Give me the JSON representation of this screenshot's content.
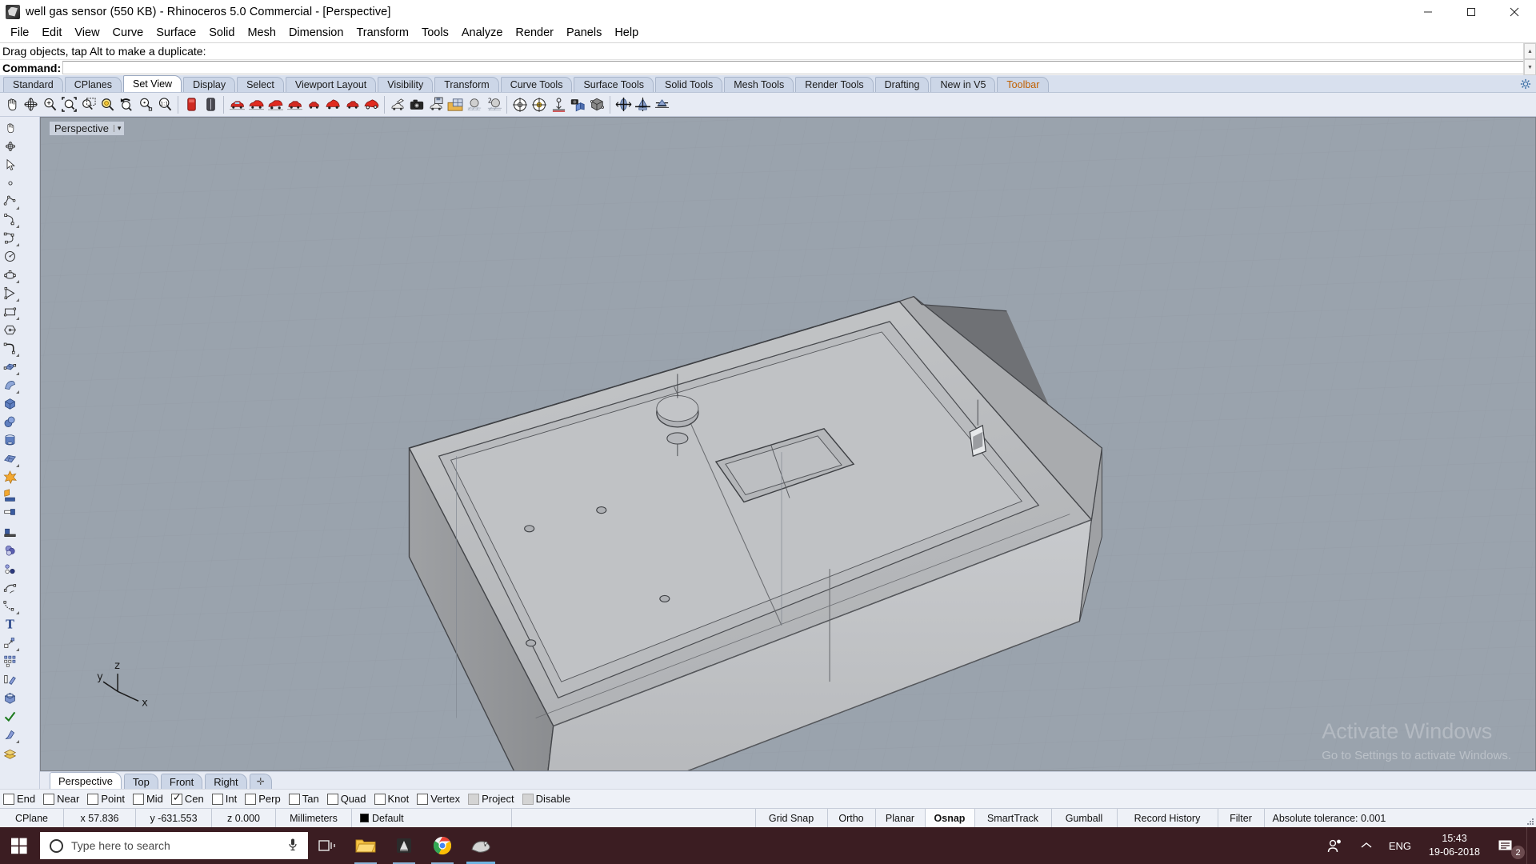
{
  "window": {
    "title": "well gas sensor (550 KB) - Rhinoceros 5.0 Commercial - [Perspective]",
    "icon": "rhino-app-icon",
    "minimize": "–",
    "maximize": "▢",
    "close": "✕"
  },
  "menubar": {
    "items": [
      "File",
      "Edit",
      "View",
      "Curve",
      "Surface",
      "Solid",
      "Mesh",
      "Dimension",
      "Transform",
      "Tools",
      "Analyze",
      "Render",
      "Panels",
      "Help"
    ]
  },
  "command_area": {
    "prompt": "Drag objects, tap Alt to make a duplicate:",
    "command_label": "Command:",
    "command_value": "",
    "command_placeholder": ""
  },
  "toolbar_tabs": {
    "items": [
      {
        "label": "Standard",
        "active": false,
        "accent": false
      },
      {
        "label": "CPlanes",
        "active": false,
        "accent": false
      },
      {
        "label": "Set View",
        "active": true,
        "accent": false
      },
      {
        "label": "Display",
        "active": false,
        "accent": false
      },
      {
        "label": "Select",
        "active": false,
        "accent": false
      },
      {
        "label": "Viewport Layout",
        "active": false,
        "accent": false
      },
      {
        "label": "Visibility",
        "active": false,
        "accent": false
      },
      {
        "label": "Transform",
        "active": false,
        "accent": false
      },
      {
        "label": "Curve Tools",
        "active": false,
        "accent": false
      },
      {
        "label": "Surface Tools",
        "active": false,
        "accent": false
      },
      {
        "label": "Solid Tools",
        "active": false,
        "accent": false
      },
      {
        "label": "Mesh Tools",
        "active": false,
        "accent": false
      },
      {
        "label": "Render Tools",
        "active": false,
        "accent": false
      },
      {
        "label": "Drafting",
        "active": false,
        "accent": false
      },
      {
        "label": "New in V5",
        "active": false,
        "accent": false
      },
      {
        "label": "Toolbar",
        "active": false,
        "accent": true
      }
    ],
    "options_icon": "gear-icon"
  },
  "icon_toolbar": {
    "groups": [
      [
        "pan-icon",
        "rotate-view-icon",
        "zoom-icon",
        "zoom-extents-icon",
        "zoom-window-icon",
        "zoom-selected-icon",
        "zoom-previous-icon",
        "zoom-dynamic-icon",
        "zoom-1to1-icon"
      ],
      [
        "named-view-icon",
        "named-cplane-icon"
      ],
      [
        "set-view-top-icon",
        "set-view-bottom-icon",
        "set-view-left-icon",
        "set-view-right-icon",
        "set-view-front-icon",
        "set-view-back-icon",
        "set-view-perspective-icon",
        "set-view-two-point-icon"
      ],
      [
        "camera-place-icon",
        "camera-icon",
        "save-viewport-icon",
        "viewport-layout-icon",
        "shaded-sphere-icon",
        "render-sphere-icon"
      ],
      [
        "target-icon",
        "target-highlight-icon",
        "place-target-icon",
        "camera-object-icon",
        "box-view-icon"
      ],
      [
        "plan-view-icon",
        "elevation-view-icon",
        "perspective-small-icon"
      ]
    ]
  },
  "side_toolbar": {
    "items": [
      "pan-tool-icon",
      "rotate-tool-icon",
      "select-arrow-icon",
      "point-icon",
      "polyline-icon",
      "arc-icon",
      "curve-icon",
      "circle-icon",
      "ellipse-icon",
      "polygon-icon",
      "rectangle-icon",
      "hexagon-icon",
      "fillet-curve-icon",
      "surface-from-curves-icon",
      "sweep-surface-icon",
      "box-solid-icon",
      "sphere-solid-icon",
      "cylinder-solid-icon",
      "mesh-plane-icon",
      "explode-icon",
      "boolean-union-icon",
      "trim-icon",
      "split-icon",
      "boolean-difference-icon",
      "offset-curve-icon",
      "blend-curve-icon",
      "extend-curve-icon",
      "text-tool-icon",
      "scale-icon",
      "array-icon",
      "extrude-icon",
      "cap-solid-icon",
      "analyze-icon",
      "paint-icon",
      "layer-icon"
    ]
  },
  "viewport": {
    "label": "Perspective",
    "dropdown_caret": "▾",
    "axis_x": "x",
    "axis_y": "y",
    "axis_z": "z",
    "background_color": "#9aa3ad",
    "grid_color": "#8d959f",
    "model_fill": "#b5b7b9",
    "model_shadow": "#7d7f82"
  },
  "watermark": {
    "line1": "Activate Windows",
    "line2": "Go to Settings to activate Windows."
  },
  "viewport_tabs": {
    "items": [
      {
        "label": "Perspective",
        "active": true
      },
      {
        "label": "Top",
        "active": false
      },
      {
        "label": "Front",
        "active": false
      },
      {
        "label": "Right",
        "active": false
      }
    ],
    "add_label": "✛"
  },
  "osnap": {
    "items": [
      {
        "label": "End",
        "checked": false,
        "disabled": false
      },
      {
        "label": "Near",
        "checked": false,
        "disabled": false
      },
      {
        "label": "Point",
        "checked": false,
        "disabled": false
      },
      {
        "label": "Mid",
        "checked": false,
        "disabled": false
      },
      {
        "label": "Cen",
        "checked": true,
        "disabled": false
      },
      {
        "label": "Int",
        "checked": false,
        "disabled": false
      },
      {
        "label": "Perp",
        "checked": false,
        "disabled": false
      },
      {
        "label": "Tan",
        "checked": false,
        "disabled": false
      },
      {
        "label": "Quad",
        "checked": false,
        "disabled": false
      },
      {
        "label": "Knot",
        "checked": false,
        "disabled": false
      },
      {
        "label": "Vertex",
        "checked": false,
        "disabled": false
      },
      {
        "label": "Project",
        "checked": false,
        "disabled": true
      },
      {
        "label": "Disable",
        "checked": false,
        "disabled": true
      }
    ]
  },
  "statusbar": {
    "cplane": "CPlane",
    "x": "x 57.836",
    "y": "y -631.553",
    "z": "z 0.000",
    "units": "Millimeters",
    "layer": "Default",
    "layer_color": "#000000",
    "grid_snap": "Grid Snap",
    "ortho": "Ortho",
    "planar": "Planar",
    "osnap": "Osnap",
    "smarttrack": "SmartTrack",
    "gumball": "Gumball",
    "record_history": "Record History",
    "filter": "Filter",
    "tolerance": "Absolute tolerance: 0.001"
  },
  "taskbar": {
    "start_icon": "windows-start-icon",
    "search_placeholder": "Type here to search",
    "search_icon": "search-circle-icon",
    "mic_icon": "microphone-icon",
    "taskview_icon": "task-view-icon",
    "apps": [
      {
        "name": "file-explorer-icon",
        "running": true
      },
      {
        "name": "sketch-app-icon",
        "running": true
      },
      {
        "name": "google-chrome-icon",
        "running": true
      },
      {
        "name": "rhinoceros-icon",
        "active": true
      }
    ],
    "tray": {
      "people_icon": "people-icon",
      "chevron_up_icon": "chevron-up-icon",
      "language": "ENG",
      "time": "15:43",
      "date": "19-06-2018",
      "notification_icon": "notification-icon",
      "notification_count": "2"
    },
    "background_color": "#3b1d22"
  }
}
